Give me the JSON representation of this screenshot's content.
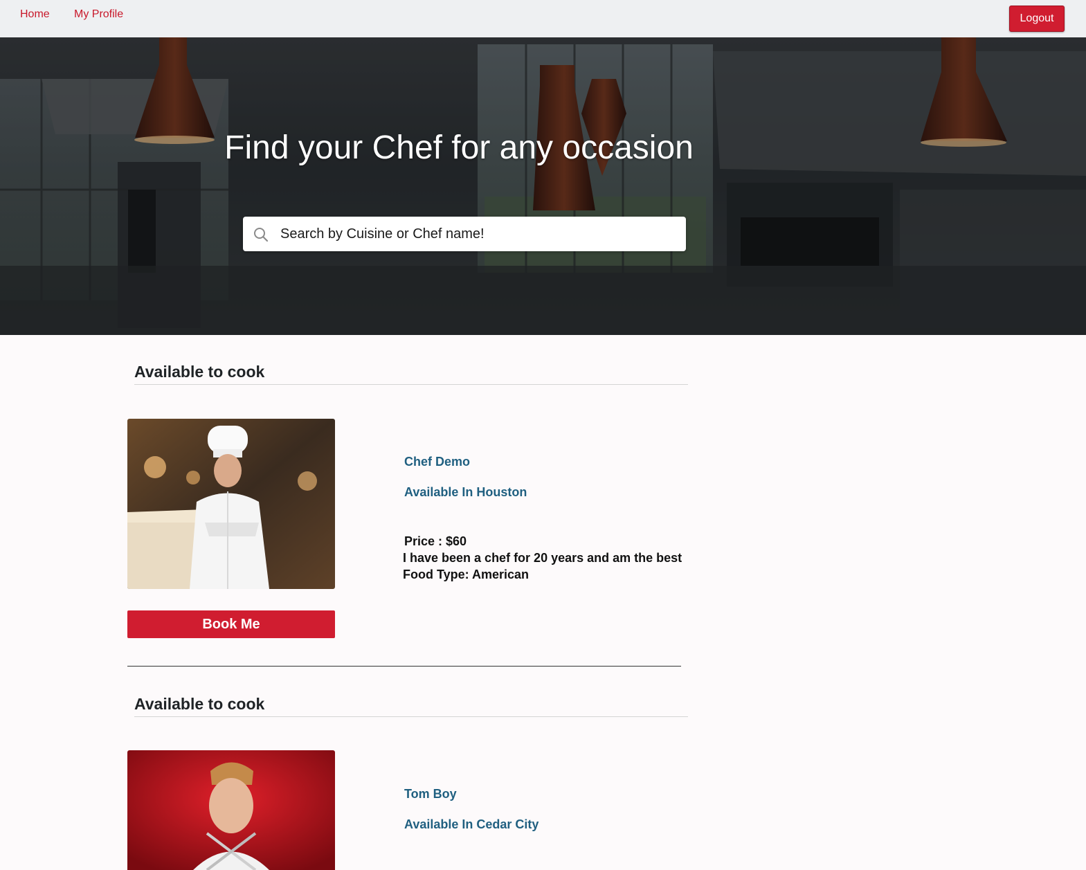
{
  "nav": {
    "home": "Home",
    "profile": "My Profile",
    "logout": "Logout"
  },
  "hero": {
    "title": "Find your Chef for any occasion",
    "search_placeholder": "Search by Cuisine or Chef name!"
  },
  "listings": [
    {
      "heading": "Available to cook",
      "name": "Chef Demo",
      "city": "Available In Houston",
      "price": "Price : $60",
      "bio": "I have been a chef for 20 years and am the best",
      "food": "Food Type: American",
      "book": "Book Me"
    },
    {
      "heading": "Available to cook",
      "name": "Tom Boy",
      "city": "Available In Cedar City"
    }
  ],
  "colors": {
    "brand_red": "#d01d30",
    "nav_link": "#c8182a",
    "chef_link": "#1f5f80"
  },
  "icons": {
    "search": "search-icon"
  }
}
